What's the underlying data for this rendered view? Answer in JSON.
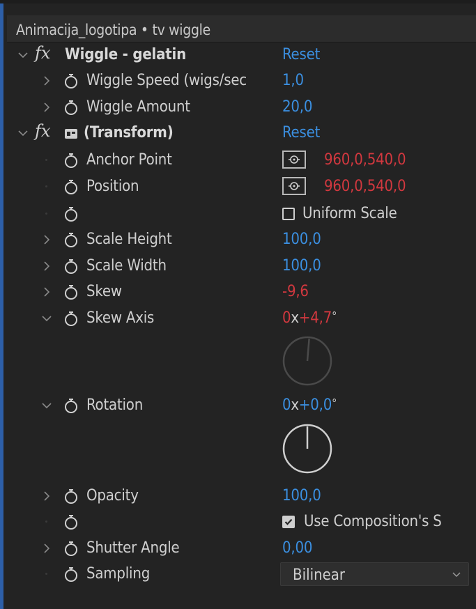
{
  "panel": {
    "title": "Animacija_logotipa • tv wiggle"
  },
  "effects": {
    "wiggle": {
      "name": "Wiggle - gelatin",
      "reset": "Reset"
    },
    "transform": {
      "name": "(Transform)",
      "reset": "Reset"
    }
  },
  "props": {
    "wiggle_speed": {
      "label": "Wiggle Speed (wigs/sec",
      "value": "1,0"
    },
    "wiggle_amount": {
      "label": "Wiggle Amount",
      "value": "20,0"
    },
    "anchor_point": {
      "label": "Anchor Point",
      "x": "960,0",
      "sep": ",",
      "y": "540,0"
    },
    "position": {
      "label": "Position",
      "x": "960,0",
      "sep": ",",
      "y": "540,0"
    },
    "uniform_scale": {
      "label": "Uniform Scale",
      "checked": false
    },
    "scale_height": {
      "label": "Scale Height",
      "value": "100,0"
    },
    "scale_width": {
      "label": "Scale Width",
      "value": "100,0"
    },
    "skew": {
      "label": "Skew",
      "value": "-9,6"
    },
    "skew_axis": {
      "label": "Skew Axis",
      "rev": "0",
      "x": "x",
      "deg": "+4,7",
      "unit": "°",
      "angle_deg": 4.7
    },
    "rotation": {
      "label": "Rotation",
      "rev": "0",
      "x": "x",
      "deg": "+0,0",
      "unit": "°",
      "angle_deg": 0
    },
    "opacity": {
      "label": "Opacity",
      "value": "100,0"
    },
    "use_comp_shutter": {
      "label": "Use Composition's S",
      "checked": true
    },
    "shutter_angle": {
      "label": "Shutter Angle",
      "value": "0,00"
    },
    "sampling": {
      "label": "Sampling",
      "value": "Bilinear"
    }
  },
  "colors": {
    "accent_blue": "#3b8fe0",
    "keyframed_red": "#d2383f",
    "panel_bg": "#232323"
  }
}
